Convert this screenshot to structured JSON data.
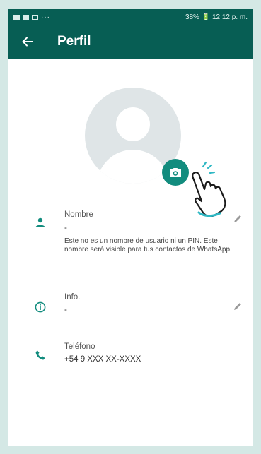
{
  "status_bar": {
    "right_text": "38% 🔋 12:12 p. m.",
    "dots": "···"
  },
  "app_bar": {
    "title": "Perfil"
  },
  "name_row": {
    "label": "Nombre",
    "value": "-",
    "description": "Este no es un nombre de usuario ni un PIN. Este nombre será visible para tus contactos de WhatsApp."
  },
  "info_row": {
    "label": "Info.",
    "value": "-"
  },
  "phone_row": {
    "label": "Teléfono",
    "value": "+54 9 XXX XX-XXXX"
  },
  "colors": {
    "brand": "#075e54",
    "accent": "#128c7e",
    "frame": "#d4e8e5"
  },
  "icons": [
    "back-arrow-icon",
    "camera-icon",
    "hand-pointer-icon",
    "person-icon",
    "info-icon",
    "phone-icon",
    "pencil-icon"
  ]
}
